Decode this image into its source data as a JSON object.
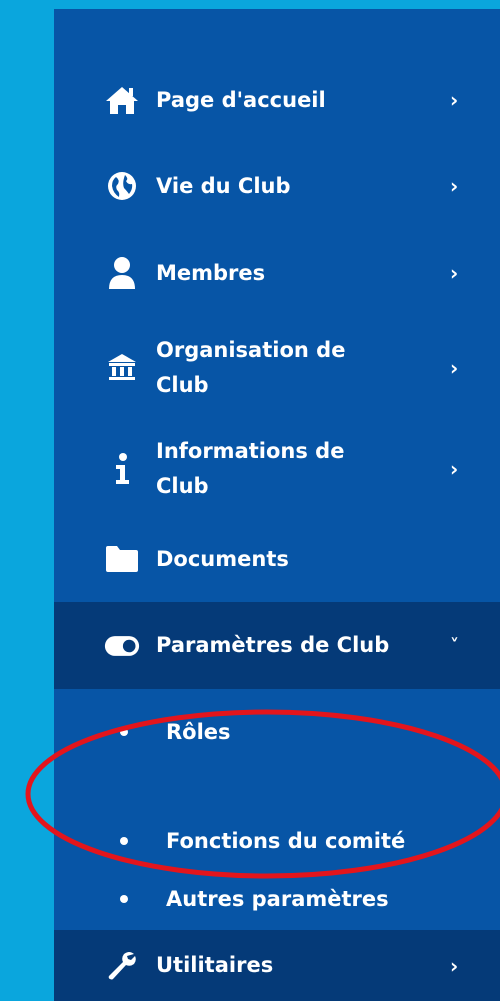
{
  "menu": {
    "items": [
      {
        "label": "Page d'accueil",
        "icon": "home-icon",
        "chevron": "›"
      },
      {
        "label": "Vie du Club",
        "icon": "globe-icon",
        "chevron": "›"
      },
      {
        "label": "Membres",
        "icon": "user-icon",
        "chevron": "›"
      },
      {
        "label": "Organisation de Club",
        "icon": "institution-icon",
        "chevron": "›"
      },
      {
        "label": "Informations de Club",
        "icon": "info-icon",
        "chevron": "›"
      },
      {
        "label": "Documents",
        "icon": "folder-icon"
      },
      {
        "label": "Paramètres de Club",
        "icon": "toggle-icon",
        "chevron": "˅",
        "expanded": true
      },
      {
        "label": "Utilitaires",
        "icon": "wrench-icon",
        "chevron": "›"
      }
    ],
    "submenu": [
      {
        "label": "Rôles"
      },
      {
        "label": "Fonctions du comité",
        "highlighted": true
      },
      {
        "label": "Autres paramètres"
      }
    ]
  },
  "colors": {
    "background": "#0aa6dd",
    "sidebar": "#0755a6",
    "active": "#053a78",
    "annotation": "#e3151c"
  }
}
